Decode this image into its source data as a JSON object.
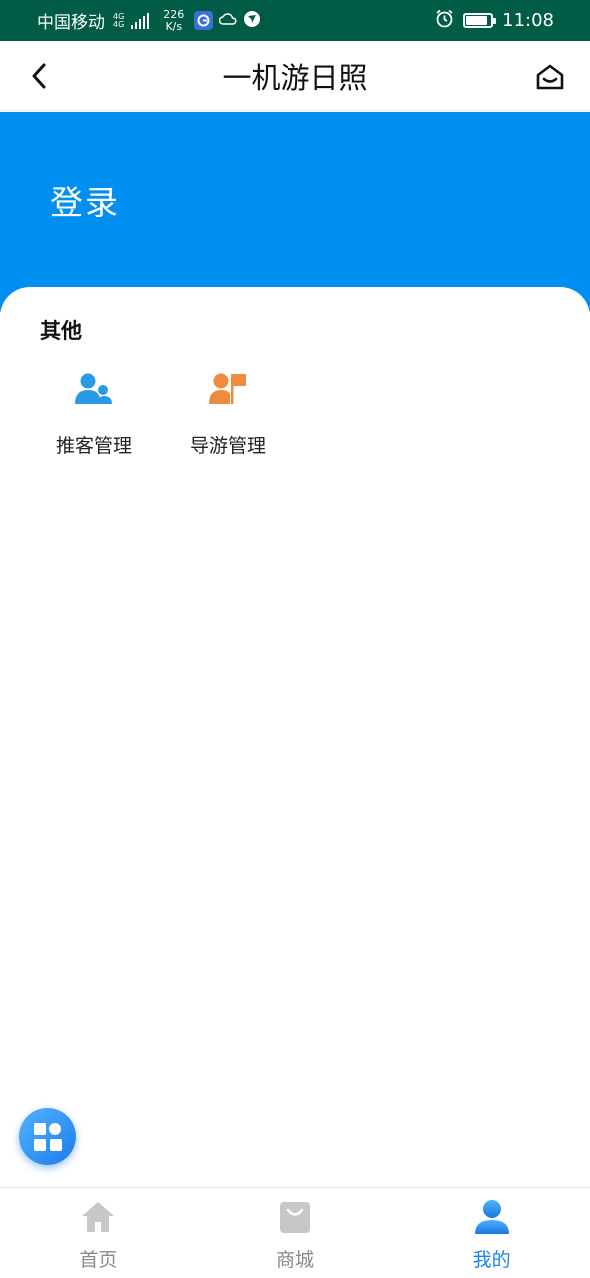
{
  "status_bar": {
    "carrier": "中国移动",
    "network": [
      "4G",
      "4G"
    ],
    "speed_value": "226",
    "speed_unit": "K/s",
    "time": "11:08",
    "battery_level": 0.85
  },
  "header": {
    "title": "一机游日照"
  },
  "banner": {
    "login_label": "登录",
    "color": "#028ff2"
  },
  "section": {
    "title": "其他",
    "items": [
      {
        "label": "推客管理",
        "icon": "users-icon",
        "color": "#2a9ae6"
      },
      {
        "label": "导游管理",
        "icon": "guide-flag-icon",
        "color": "#f08a3c"
      }
    ]
  },
  "tabbar": {
    "tabs": [
      {
        "label": "首页",
        "icon": "home-icon",
        "active": false
      },
      {
        "label": "商城",
        "icon": "shopping-bag-icon",
        "active": false
      },
      {
        "label": "我的",
        "icon": "profile-icon",
        "active": true
      }
    ],
    "active_color": "#1a86e8"
  }
}
